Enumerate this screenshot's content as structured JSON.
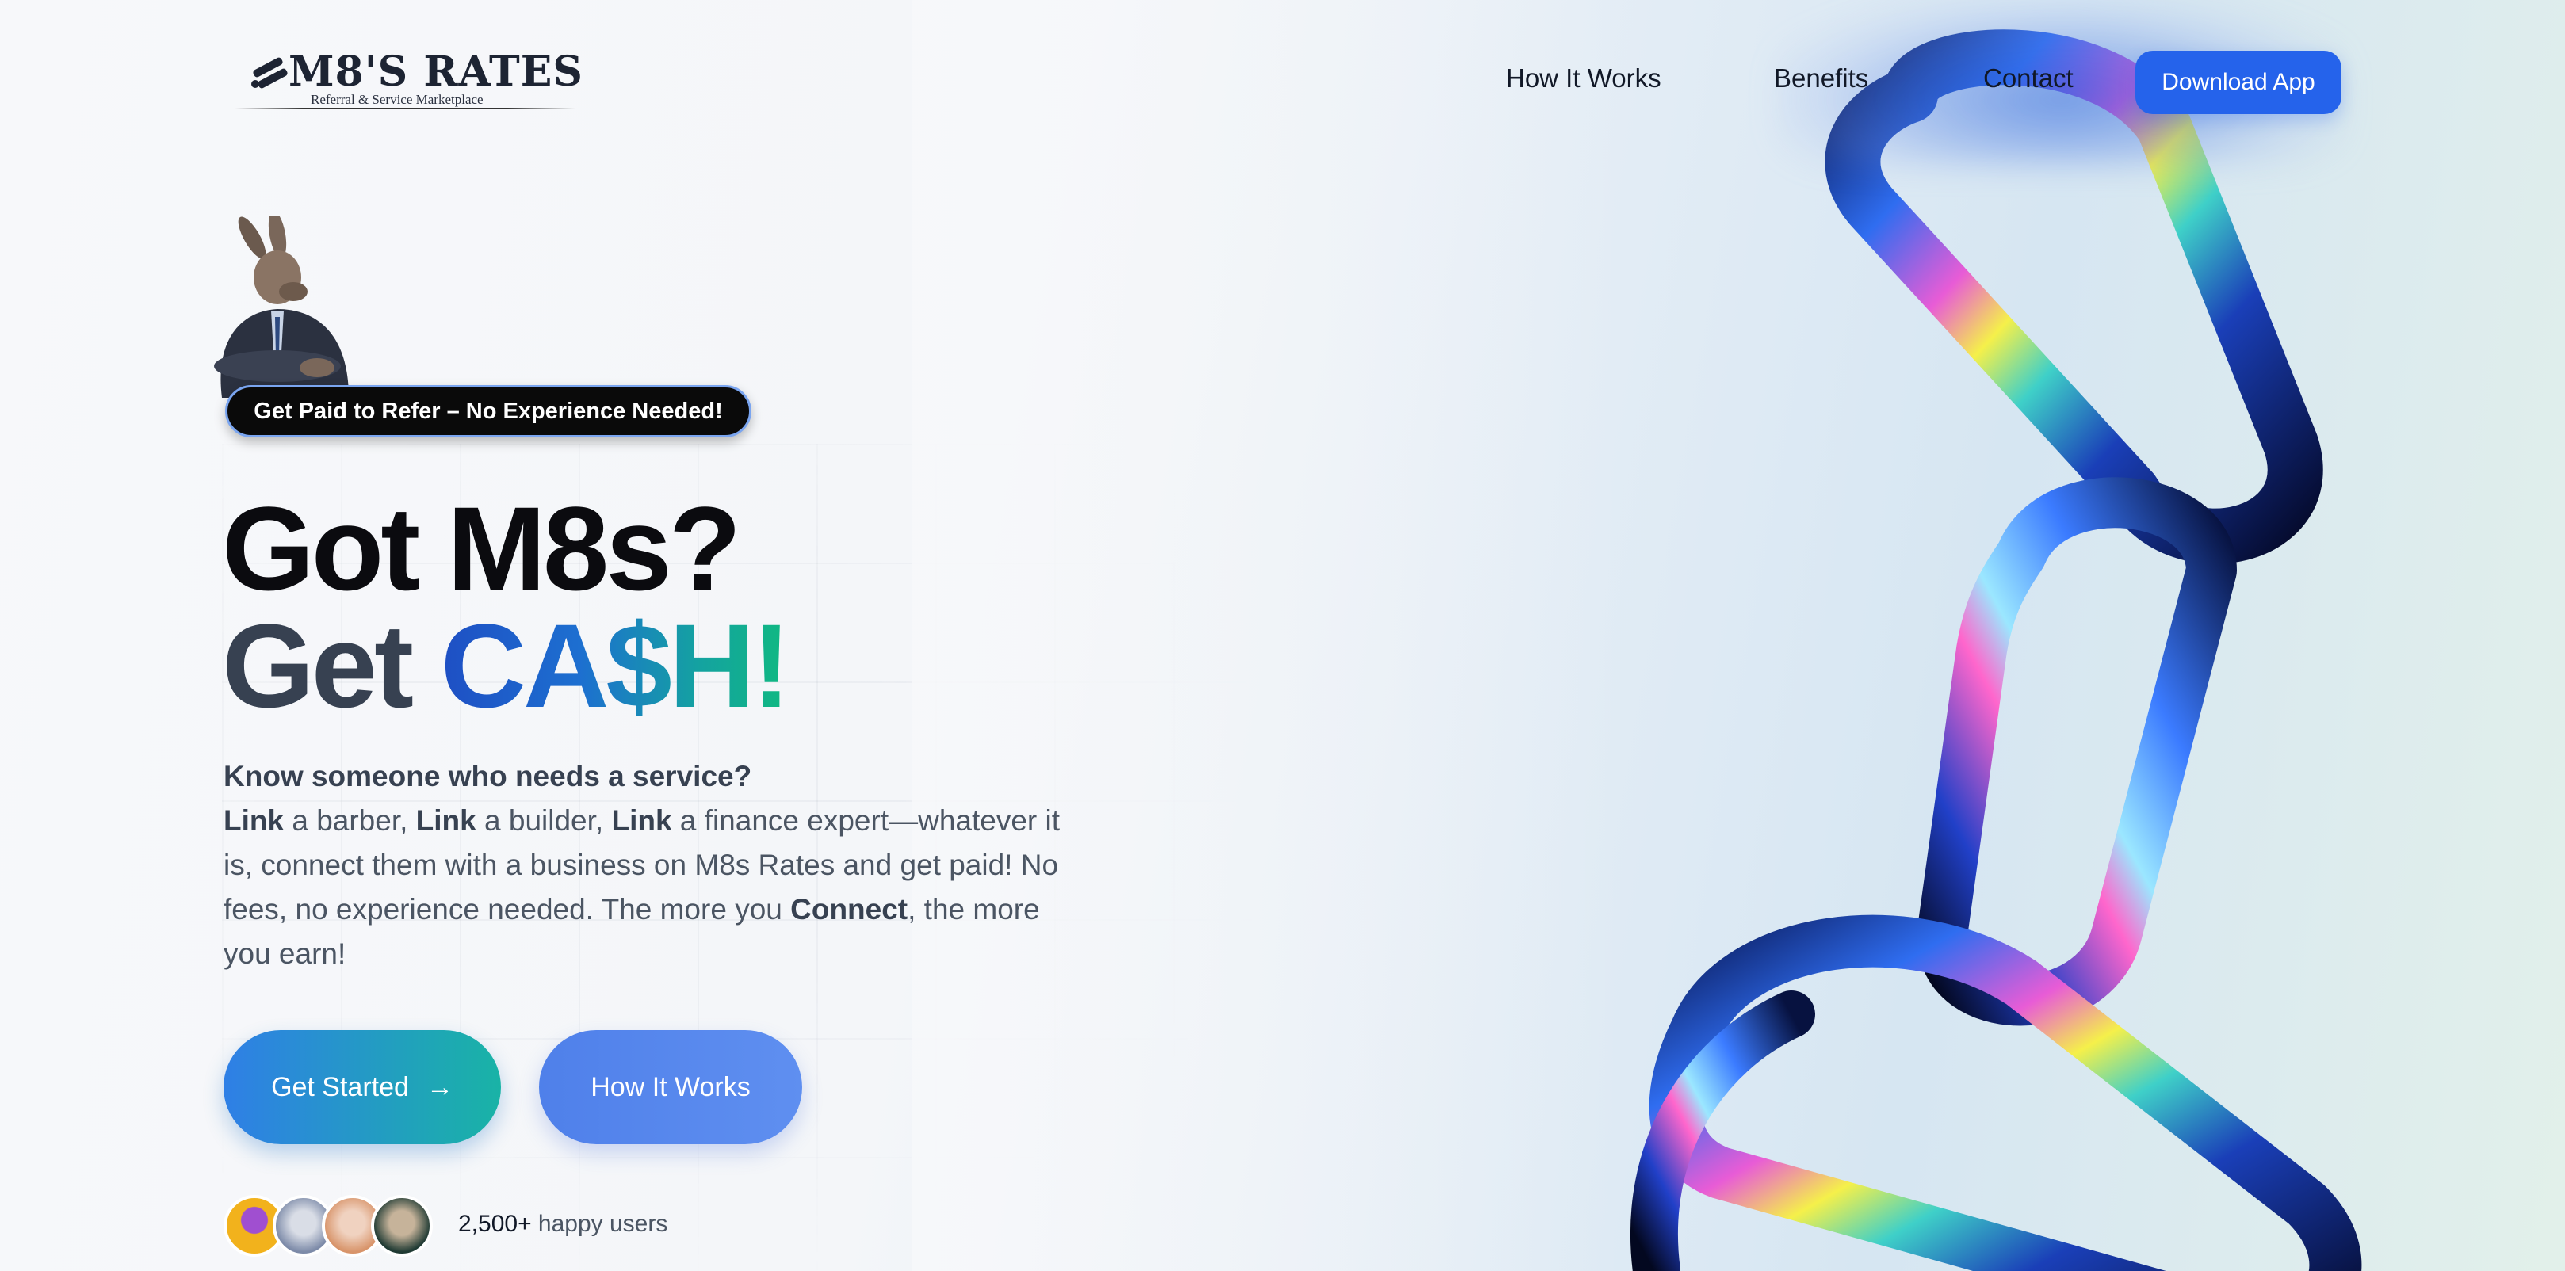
{
  "header": {
    "brand_title": "M8'S RATES",
    "brand_subtitle": "Referral & Service Marketplace",
    "nav": [
      {
        "label": "How It Works"
      },
      {
        "label": "Benefits"
      },
      {
        "label": "Contact"
      }
    ],
    "download_label": "Download App"
  },
  "hero": {
    "tagline": "Get Paid to Refer – No Experience Needed!",
    "headline_line1": "Got M8s?",
    "headline_get": "Get",
    "headline_cash": "CA$H!",
    "intro_bold": "Know someone who needs a service?",
    "link_word": "Link",
    "seg_barber": " a barber, ",
    "seg_builder": " a builder, ",
    "seg_finance": " a finance expert—whatever it is, connect them with a business on M8s Rates and get paid! No fees, no experience needed. The more you ",
    "connect_word": "Connect",
    "seg_end": ", the more you earn!",
    "cta_primary": "Get Started",
    "cta_arrow": "→",
    "cta_secondary": "How It Works",
    "users_count": "2,500+",
    "users_label": " happy users"
  },
  "icons": {
    "logo": "logo-mark-icon",
    "arrow": "arrow-right-icon",
    "mascot": "kangaroo-mascot",
    "chain": "chrome-chain-illustration"
  },
  "colors": {
    "brand_blue": "#2563eb",
    "cash_gradient_start": "#1e4fc4",
    "cash_gradient_end": "#10b981",
    "pill_bg": "#0a0a0a"
  }
}
